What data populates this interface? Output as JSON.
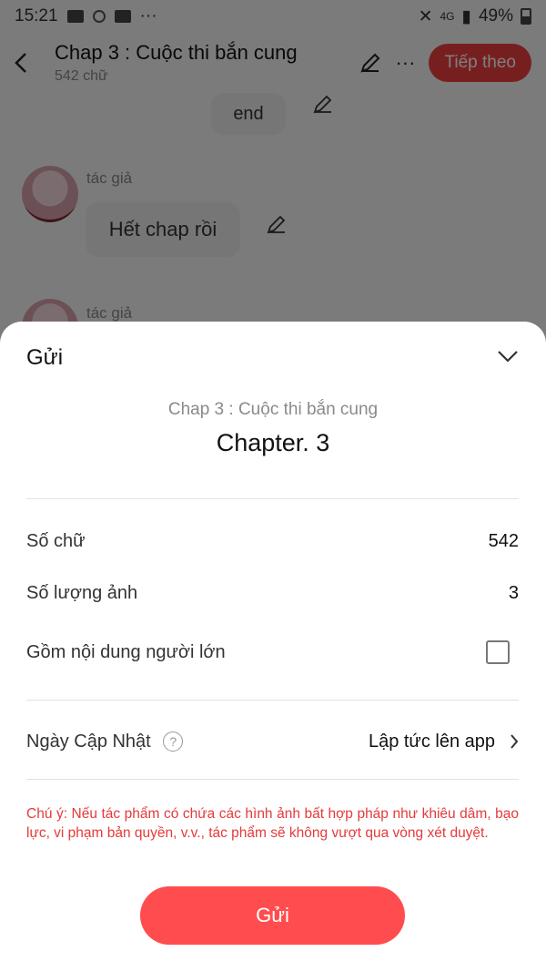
{
  "status_bar": {
    "time": "15:21",
    "battery": "49%",
    "network": "4G"
  },
  "header": {
    "back_icon": "chevron-left-icon",
    "chapter_title": "Chap 3 : Cuộc thi bắn cung",
    "word_count_label": "542 chữ",
    "edit_icon": "pencil-icon",
    "more_label": "···",
    "next_label": "Tiếp theo"
  },
  "chat": {
    "end_bubble": "end",
    "author_label": "tác giả",
    "message": "Hết chap rồi",
    "author_label_2": "tác giả"
  },
  "sheet": {
    "title": "Gửi",
    "collapse_icon": "chevron-down-icon",
    "chapter_name": "Chap 3 : Cuộc thi bắn cung",
    "chapter_label": "Chapter. 3",
    "rows": {
      "words": {
        "label": "Số chữ",
        "value": "542"
      },
      "images": {
        "label": "Số lượng ảnh",
        "value": "3"
      },
      "adult": {
        "label": "Gồm nội dung người lớn",
        "checked": false
      },
      "update": {
        "label": "Ngày Cập Nhật",
        "value": "Lập tức lên app",
        "help": "?"
      }
    },
    "note": "Chú ý: Nếu tác phẩm có chứa các hình ảnh bất hợp pháp như khiêu dâm, bạo lực, vi phạm bản quyền, v.v., tác phẩm sẽ không vượt qua vòng xét duyệt.",
    "send_label": "Gửi"
  },
  "colors": {
    "accent": "#ff4d4f",
    "next_button": "#ef3f3f",
    "note_red": "#e53a3a"
  }
}
